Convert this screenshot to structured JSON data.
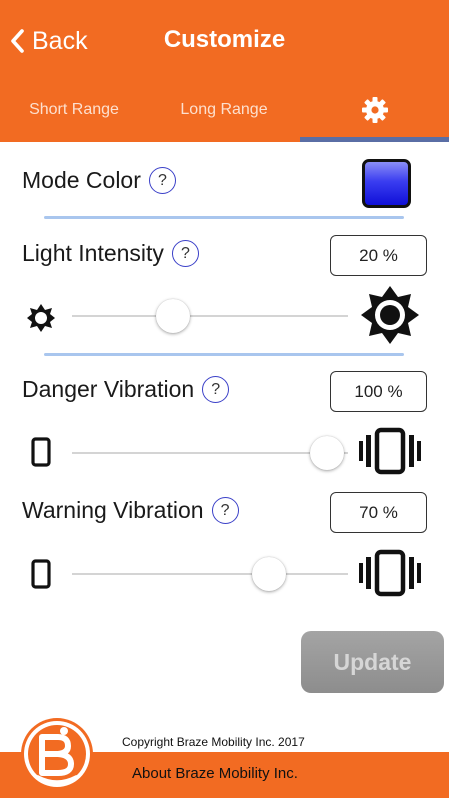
{
  "header": {
    "back_label": "Back",
    "title": "Customize",
    "tabs": [
      {
        "label": "Short Range"
      },
      {
        "label": "Long Range"
      },
      {
        "icon": "gear-icon"
      }
    ],
    "active_tab": "gear-icon"
  },
  "settings": {
    "mode_color": {
      "label": "Mode Color",
      "help": "?",
      "color": "#1a1ae0"
    },
    "light_intensity": {
      "label": "Light Intensity",
      "help": "?",
      "value": "20 %",
      "level": 0.2
    },
    "danger_vibration": {
      "label": "Danger Vibration",
      "help": "?",
      "value": "100 %",
      "level": 1.0
    },
    "warning_vibration": {
      "label": "Warning Vibration",
      "help": "?",
      "value": "70 %",
      "level": 0.7
    }
  },
  "update_button": {
    "label": "Update"
  },
  "footer": {
    "copyright": "Copyright Braze Mobility Inc. 2017",
    "about": "About Braze Mobility Inc."
  },
  "colors": {
    "brand": "#f26b22",
    "divider": "#a9c6ee",
    "tab_indicator": "#5a6ea5",
    "help_ring": "#3b40c8"
  }
}
